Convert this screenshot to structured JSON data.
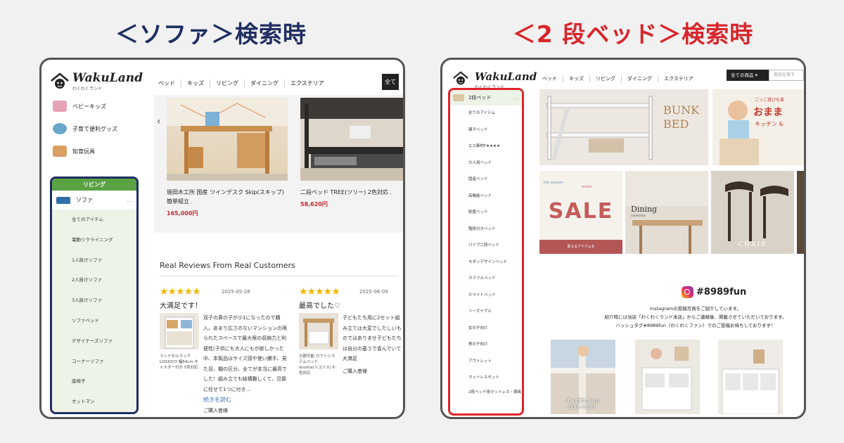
{
  "titles": {
    "left": "＜ソファ＞検索時",
    "right": "＜2 段ベッド＞検索時"
  },
  "colors": {
    "left_title": "#1f2f62",
    "right_title": "#d8262b",
    "liv_header": "#5aa244",
    "price": "#c6262f",
    "stars": "#f2b600"
  },
  "logo": {
    "text": "WakuLand",
    "sub": "わくわくランド",
    "icon": "house-kid-logo-icon"
  },
  "nav": [
    "ベッド",
    "キッズ",
    "リビング",
    "ダイニング",
    "エクステリア"
  ],
  "left": {
    "all_button": "全て",
    "categories": [
      {
        "label": "ベビーキッズ",
        "icon": "baby-icon",
        "color": "#e6a3b8"
      },
      {
        "label": "子育て便利グッズ",
        "icon": "childcare-icon",
        "color": "#6aa7c9"
      },
      {
        "label": "知育玩具",
        "icon": "toy-icon",
        "color": "#d9a062"
      }
    ],
    "living_header": "リビング",
    "sofa_label": "ソファ",
    "sofa_dots": "…",
    "sofa_sub": [
      "全てのアイテム",
      "電動リクライニング",
      "1人掛けソファ",
      "2人掛けソファ",
      "3人掛けソファ",
      "ソファベッド",
      "デザイナーズソファ",
      "コーナーソファ",
      "座椅子",
      "オットマン"
    ],
    "carousel_prev": "‹",
    "products": [
      {
        "name": "堀田木工所 国産 ツインデスク Skip(スキップ) 簡単組立 .",
        "price": "165,000円"
      },
      {
        "name": "二段ベッド TREE(ツリー) 2色対応 .",
        "price": "58,620円"
      }
    ],
    "reviews_title": "Real Reviews From Real Customers",
    "reviews": [
      {
        "stars": "★★★★★",
        "date": "2025-05-28",
        "headline": "大満足です！",
        "thumb_caption": "ランドセルラック LOGIO(ロ 幅64cm キャスター付き 5色対応",
        "body": "双子の男の子が小1になったので購入。あまり広さのないマンションの限られたスペースで最大限の収納力と利便性(子供にも大人にもが欲しかった中、本製品はサイズ感や使い勝手、見た目、棚の区分、全てが本当に最高でした！組み立ても結構難しくて、旦那に任せて1つに付き…",
        "more": "続きを読む",
        "buyer": "ご購入者様"
      },
      {
        "stars": "★★★★★",
        "date": "2025-06-09",
        "headline": "最高でした♡",
        "thumb_caption": "分割可能 ロフトシステムベッド licorice(リコリス) 6色対応",
        "body": "子どもたち用に2セット組み立ては大変でしたしいものではありませ子どもたちは自分の基うで喜んでいて大満足",
        "buyer": "ご購入者様"
      }
    ]
  },
  "right": {
    "select_label": "全ての商品",
    "search_placeholder": "商品を探す",
    "bed_header": "2段ベッド",
    "bed_dots": "…",
    "bed_sub": [
      "全てのアイテム",
      "親子ベッド",
      "エコ素材F★★★★",
      "大人用ベッド",
      "国産ベッド",
      "高機能ベッド",
      "耐震ベッド",
      "階段付きベッド",
      "パイプ二段ベッド",
      "モダンデザインベッド",
      "カラフルベッド",
      "ホワイトベッド",
      "リーズナブル",
      "女の子向け",
      "男の子向け",
      "アウトレット",
      "マットレスセット",
      "2段ベッド用マットレス・寝具"
    ],
    "banners": {
      "bunk1": "BUNK",
      "bunk2": "BED",
      "kitchen1": "ごっこ遊びも楽",
      "kitchen2": "おまま",
      "kitchen3": "キッチン &",
      "sale_top": "the season",
      "sale_mid": "outlet",
      "sale": "SALE",
      "sale_note": "愛えるアイテムを",
      "dining": "Dining",
      "dining_sub": "collection",
      "chair": "CHAIR"
    },
    "insta_tag": "#8989fun",
    "insta_lines": [
      "Instagramの投稿写真をご紹介しています。",
      "紹介時には当店「わくわくランド本店」からご連絡後、掲載させていただいております。",
      "ハッシュタグ#8989fun（わくわくファン）でのご投稿お待ちしております！"
    ],
    "insta_pic_caption": "ずっと欲しかった\nロフトベッド！"
  }
}
